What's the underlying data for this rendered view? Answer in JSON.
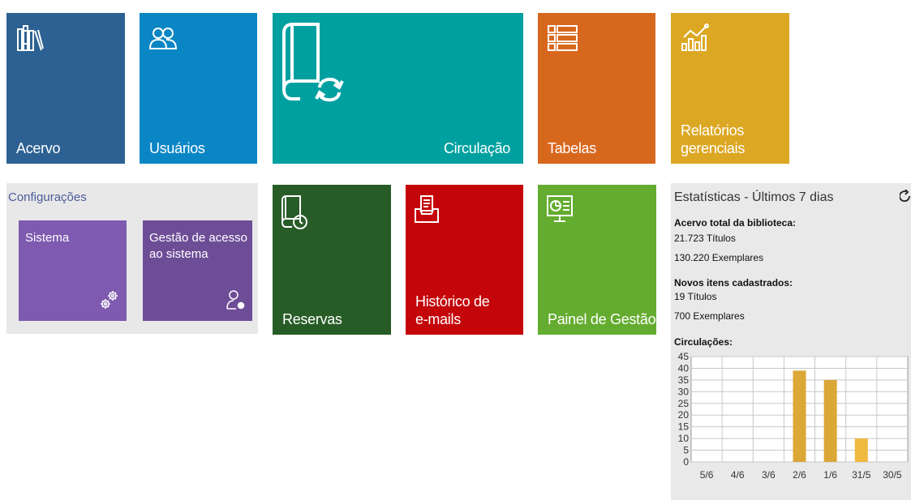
{
  "tiles": {
    "acervo": "Acervo",
    "usuarios": "Usuários",
    "circulacao": "Circulação",
    "tabelas": "Tabelas",
    "relatorios": [
      "Relatórios",
      "gerenciais"
    ],
    "reservas": "Reservas",
    "historico": [
      "Histórico de",
      "e-mails"
    ],
    "painel": "Painel de Gestão"
  },
  "configuracoes": {
    "title": "Configurações",
    "sistema": "Sistema",
    "gestao": [
      "Gestão de acesso",
      "ao sistema"
    ]
  },
  "stats": {
    "title": "Estatísticas - Últimos 7 dias",
    "acervo_label": "Acervo total da biblioteca:",
    "acervo_titulos": "21.723 Títulos",
    "acervo_exemplares": "130.220 Exemplares",
    "novos_label": "Novos itens cadastrados:",
    "novos_titulos": "19 Títulos",
    "novos_exemplares": "700 Exemplares",
    "circ_label": "Circulações:"
  },
  "chart_data": {
    "type": "bar",
    "categories": [
      "5/6",
      "4/6",
      "3/6",
      "2/6",
      "1/6",
      "31/5",
      "30/5"
    ],
    "values": [
      0,
      0,
      0,
      39,
      35,
      10,
      0
    ],
    "ylim": [
      0,
      45
    ],
    "yticks": [
      0,
      5,
      10,
      15,
      20,
      25,
      30,
      35,
      40,
      45
    ],
    "grid": true,
    "colors": [
      "#dba737",
      "#dba737",
      "#dba737",
      "#dba737",
      "#dba737",
      "#f0b940",
      "#f0b940"
    ]
  },
  "icons": {
    "acervo": "books-icon",
    "usuarios": "users-icon",
    "circulacao": "book-refresh-icon",
    "tabelas": "table-list-icon",
    "relatorios": "bar-chart-trend-icon",
    "reservas": "book-clock-icon",
    "historico": "inbox-document-icon",
    "painel": "monitor-dashboard-icon",
    "sistema": "gears-icon",
    "gestao": "user-gear-icon",
    "refresh": "refresh-icon"
  }
}
